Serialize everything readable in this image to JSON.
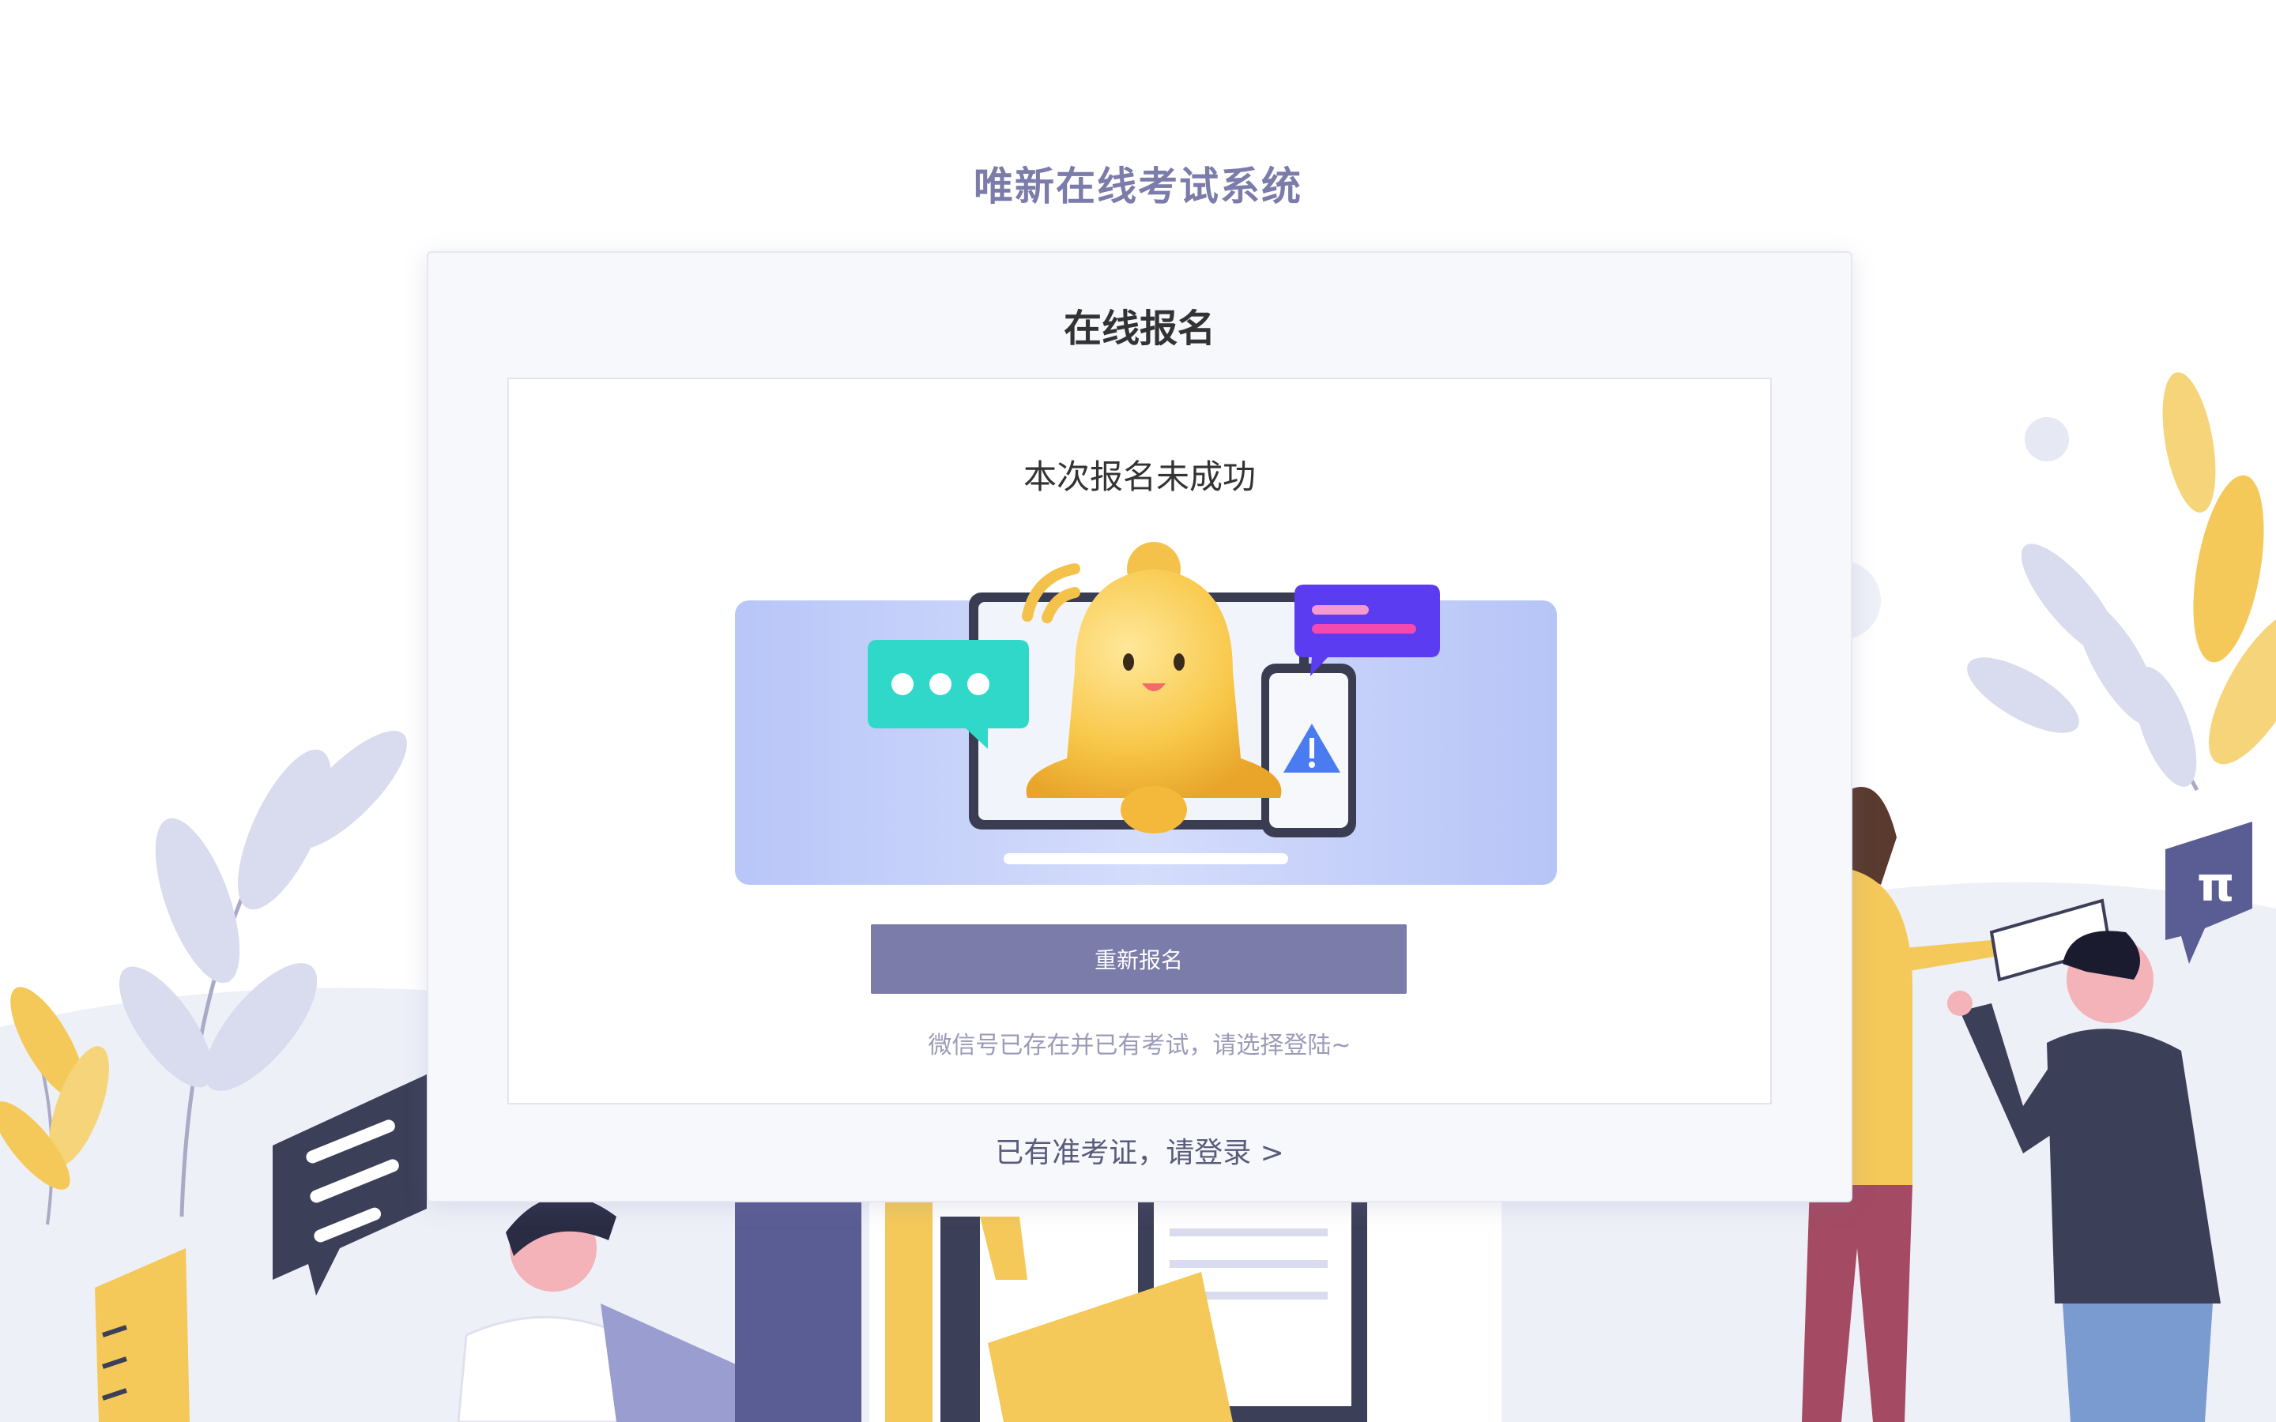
{
  "header": {
    "title": "唯新在线考试系统"
  },
  "card": {
    "title": "在线报名",
    "status_text": "本次报名未成功",
    "retry_button_label": "重新报名",
    "hint_text": "微信号已存在并已有考试，请选择登陆~",
    "login_link": "已有准考证，请登录 >"
  },
  "colors": {
    "brand": "#7b7ca9",
    "card_background": "#f7f8fc",
    "hint": "#9a9bb8"
  },
  "icons": {
    "status_illustration": "bell-notification-illustration"
  }
}
